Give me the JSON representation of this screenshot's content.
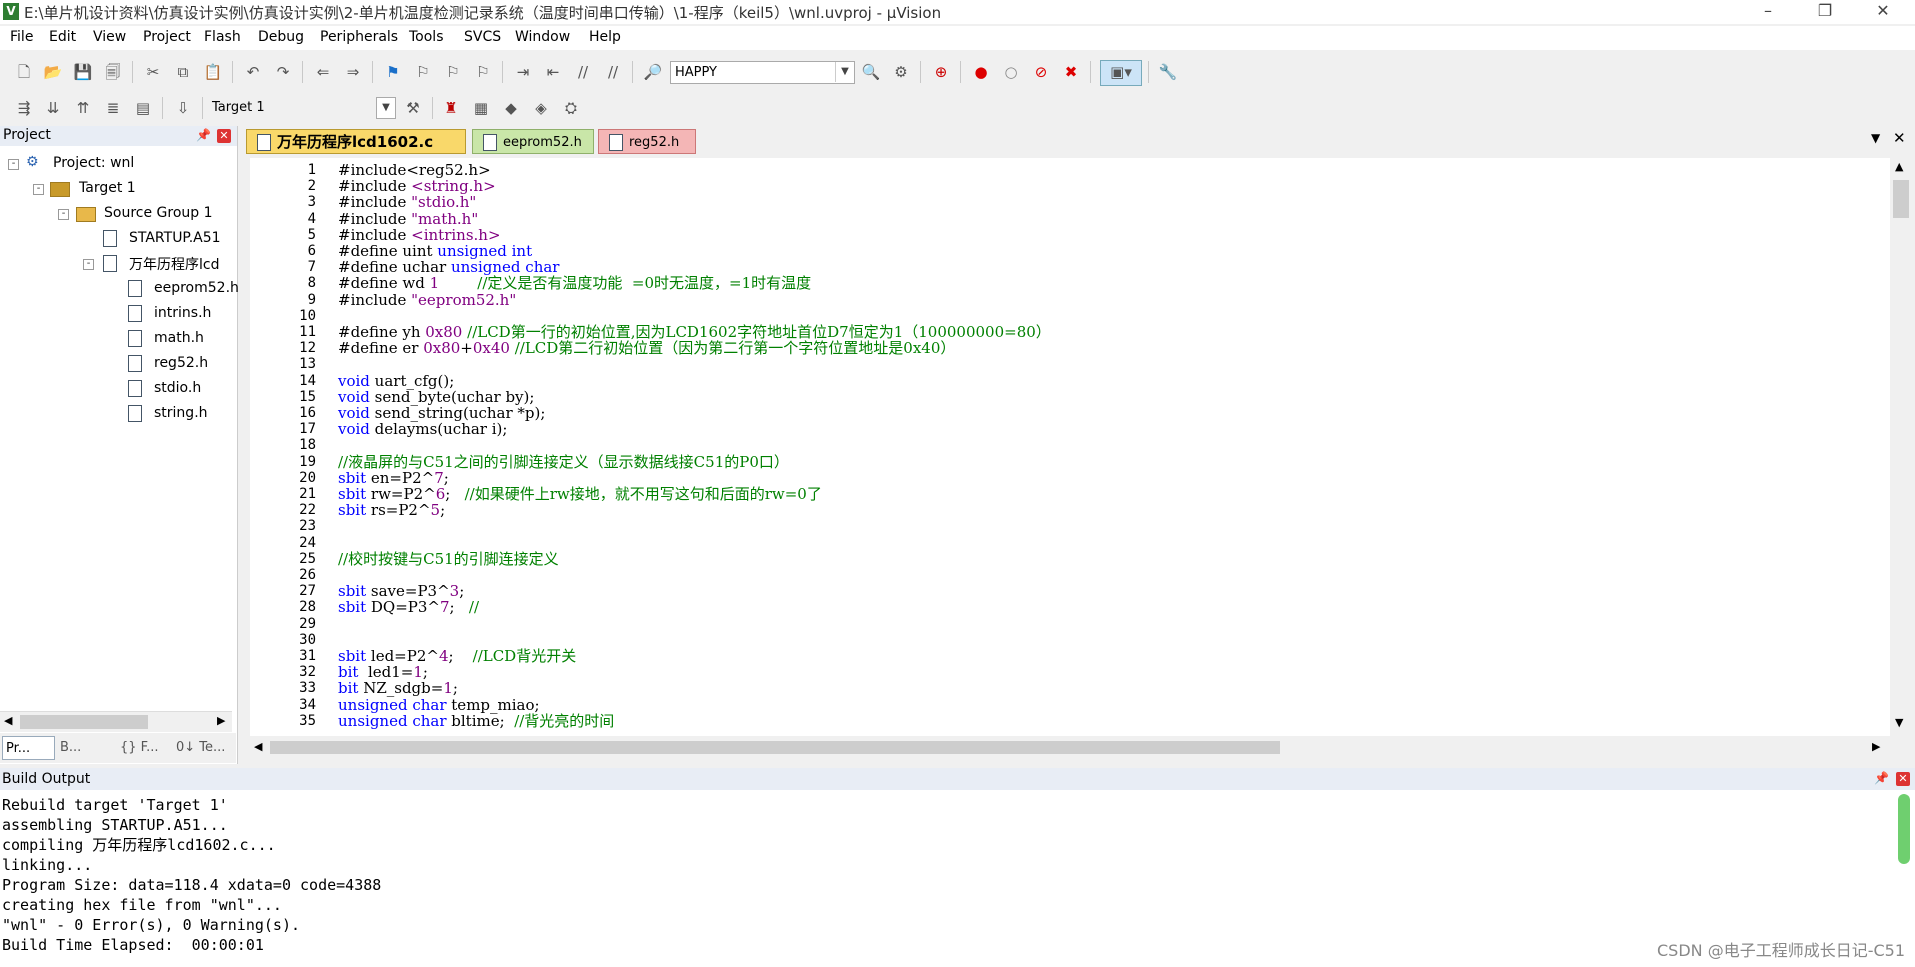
{
  "window": {
    "title": "E:\\单片机设计资料\\仿真设计实例\\仿真设计实例\\2-单片机温度检测记录系统（温度时间串口传输）\\1-程序（keil5）\\wnl.uvproj - µVision",
    "icon": "uvision-icon",
    "controls": {
      "minimize": "–",
      "restore": "❐",
      "close": "✕"
    }
  },
  "menu": [
    "File",
    "Edit",
    "View",
    "Project",
    "Flash",
    "Debug",
    "Peripherals",
    "Tools",
    "SVCS",
    "Window",
    "Help"
  ],
  "toolbar1": {
    "find_combo": "HAPPY"
  },
  "toolbar2": {
    "target_combo": "Target 1"
  },
  "project_panel": {
    "title": "Project",
    "tree": [
      {
        "label": "Project: wnl",
        "icon": "project-icon",
        "expander": "-"
      },
      {
        "label": "Target 1",
        "icon": "target-icon",
        "expander": "-"
      },
      {
        "label": "Source Group 1",
        "icon": "folder-icon",
        "expander": "-"
      },
      {
        "label": "STARTUP.A51",
        "icon": "file-icon"
      },
      {
        "label": "万年历程序lcd",
        "icon": "file-icon",
        "expander": "-"
      },
      {
        "label": "eeprom52.h",
        "icon": "file-icon"
      },
      {
        "label": "intrins.h",
        "icon": "file-icon"
      },
      {
        "label": "math.h",
        "icon": "file-icon"
      },
      {
        "label": "reg52.h",
        "icon": "file-icon"
      },
      {
        "label": "stdio.h",
        "icon": "file-icon"
      },
      {
        "label": "string.h",
        "icon": "file-icon"
      }
    ],
    "bottom_tabs": [
      "Pr...",
      "B...",
      "{} F...",
      "0↓ Te..."
    ]
  },
  "editor": {
    "tabs": [
      {
        "label": "万年历程序lcd1602.c",
        "active": true,
        "color": "#f9d86a"
      },
      {
        "label": "eeprom52.h",
        "active": false,
        "color": "#c9e6a8"
      },
      {
        "label": "reg52.h",
        "active": false,
        "color": "#f4b6b6"
      }
    ],
    "lines": [
      [
        [
          "pp",
          "#include<reg52.h>"
        ]
      ],
      [
        [
          "pp",
          "#include "
        ],
        [
          "st",
          "<string.h>"
        ]
      ],
      [
        [
          "pp",
          "#include "
        ],
        [
          "st",
          "\"stdio.h\""
        ]
      ],
      [
        [
          "pp",
          "#include "
        ],
        [
          "st",
          "\"math.h\""
        ]
      ],
      [
        [
          "pp",
          "#include "
        ],
        [
          "st",
          "<intrins.h>"
        ]
      ],
      [
        [
          "pp",
          "#define uint "
        ],
        [
          "kw",
          "unsigned int"
        ]
      ],
      [
        [
          "pp",
          "#define uchar "
        ],
        [
          "kw",
          "unsigned char"
        ]
      ],
      [
        [
          "pp",
          "#define wd "
        ],
        [
          "num",
          "1"
        ],
        [
          "pp",
          "        "
        ],
        [
          "cm",
          "//定义是否有温度功能  =0时无温度，=1时有温度"
        ]
      ],
      [
        [
          "pp",
          "#include "
        ],
        [
          "st",
          "\"eeprom52.h\""
        ]
      ],
      [],
      [
        [
          "pp",
          "#define yh "
        ],
        [
          "num",
          "0x80"
        ],
        [
          "pp",
          " "
        ],
        [
          "cm",
          "//LCD第一行的初始位置,因为LCD1602字符地址首位D7恒定为1（100000000=80）"
        ]
      ],
      [
        [
          "pp",
          "#define er "
        ],
        [
          "num",
          "0x80"
        ],
        [
          "pp",
          "+"
        ],
        [
          "num",
          "0x40"
        ],
        [
          "pp",
          " "
        ],
        [
          "cm",
          "//LCD第二行初始位置（因为第二行第一个字符位置地址是0x40）"
        ]
      ],
      [],
      [
        [
          "kw",
          "void"
        ],
        [
          "pp",
          " uart_cfg();"
        ]
      ],
      [
        [
          "kw",
          "void"
        ],
        [
          "pp",
          " send_byte(uchar by);"
        ]
      ],
      [
        [
          "kw",
          "void"
        ],
        [
          "pp",
          " send_string(uchar *p);"
        ]
      ],
      [
        [
          "kw",
          "void"
        ],
        [
          "pp",
          " delayms(uchar i);"
        ]
      ],
      [],
      [
        [
          "cm",
          "//液晶屏的与C51之间的引脚连接定义（显示数据线接C51的P0口）"
        ]
      ],
      [
        [
          "kw",
          "sbit"
        ],
        [
          "pp",
          " en=P2^"
        ],
        [
          "num",
          "7"
        ],
        [
          "pp",
          ";"
        ]
      ],
      [
        [
          "kw",
          "sbit"
        ],
        [
          "pp",
          " rw=P2^"
        ],
        [
          "num",
          "6"
        ],
        [
          "pp",
          ";   "
        ],
        [
          "cm",
          "//如果硬件上rw接地，就不用写这句和后面的rw=0了"
        ]
      ],
      [
        [
          "kw",
          "sbit"
        ],
        [
          "pp",
          " rs=P2^"
        ],
        [
          "num",
          "5"
        ],
        [
          "pp",
          ";"
        ]
      ],
      [],
      [],
      [
        [
          "cm",
          "//校时按键与C51的引脚连接定义"
        ]
      ],
      [],
      [
        [
          "kw",
          "sbit"
        ],
        [
          "pp",
          " save=P3^"
        ],
        [
          "num",
          "3"
        ],
        [
          "pp",
          ";"
        ]
      ],
      [
        [
          "kw",
          "sbit"
        ],
        [
          "pp",
          " DQ=P3^"
        ],
        [
          "num",
          "7"
        ],
        [
          "pp",
          ";   "
        ],
        [
          "cm",
          "//"
        ]
      ],
      [],
      [],
      [
        [
          "kw",
          "sbit"
        ],
        [
          "pp",
          " led=P2^"
        ],
        [
          "num",
          "4"
        ],
        [
          "pp",
          ";    "
        ],
        [
          "cm",
          "//LCD背光开关"
        ]
      ],
      [
        [
          "kw",
          "bit"
        ],
        [
          "pp",
          "  led1="
        ],
        [
          "num",
          "1"
        ],
        [
          "pp",
          ";"
        ]
      ],
      [
        [
          "kw",
          "bit"
        ],
        [
          "pp",
          " NZ_sdgb="
        ],
        [
          "num",
          "1"
        ],
        [
          "pp",
          ";"
        ]
      ],
      [
        [
          "kw",
          "unsigned char"
        ],
        [
          "pp",
          " temp_miao;"
        ]
      ],
      [
        [
          "kw",
          "unsigned char"
        ],
        [
          "pp",
          " bltime;  "
        ],
        [
          "cm",
          "//背光亮的时间"
        ]
      ]
    ]
  },
  "build_output": {
    "title": "Build Output",
    "lines": [
      "Rebuild target 'Target 1'",
      "assembling STARTUP.A51...",
      "compiling 万年历程序lcd1602.c...",
      "linking...",
      "Program Size: data=118.4 xdata=0 code=4388",
      "creating hex file from \"wnl\"...",
      "\"wnl\" - 0 Error(s), 0 Warning(s).",
      "Build Time Elapsed:  00:00:01"
    ]
  },
  "watermark": "CSDN @电子工程师成长日记-C51"
}
